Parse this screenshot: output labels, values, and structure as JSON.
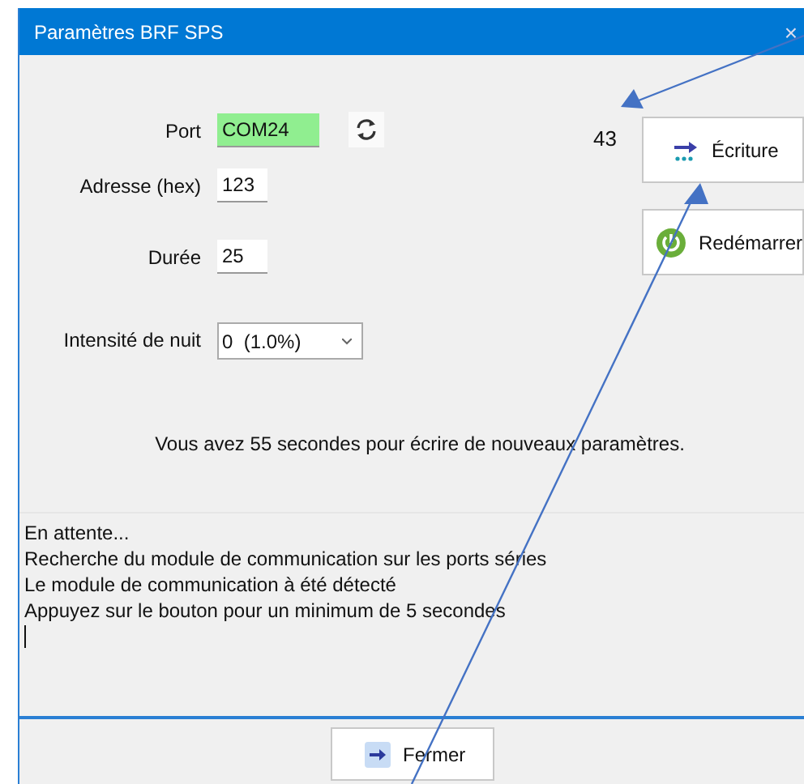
{
  "window": {
    "title": "Paramètres BRF SPS",
    "close": "×"
  },
  "fields": [
    {
      "kind": "port",
      "label": "Port",
      "value": "COM24",
      "connected": true
    },
    {
      "kind": "text",
      "label": "Adresse (hex)",
      "value": "123"
    },
    {
      "kind": "text",
      "label": "Durée",
      "value": "25"
    },
    {
      "kind": "combo",
      "label": "Intensité de nuit",
      "value": "0  (1.0%)"
    }
  ],
  "counter": "43",
  "actions": [
    {
      "kind": "write",
      "label": "Écriture"
    },
    {
      "kind": "restart",
      "label": "Redémarrer"
    }
  ],
  "message": "Vous avez 55 secondes pour écrire de nouveaux paramètres.",
  "log": [
    "En attente...",
    "Recherche du module de communication sur les ports séries",
    "Le module de communication à été détecté",
    "Appuyez sur le bouton pour un minimum de 5 secondes"
  ],
  "close_button": {
    "label": "Fermer"
  }
}
